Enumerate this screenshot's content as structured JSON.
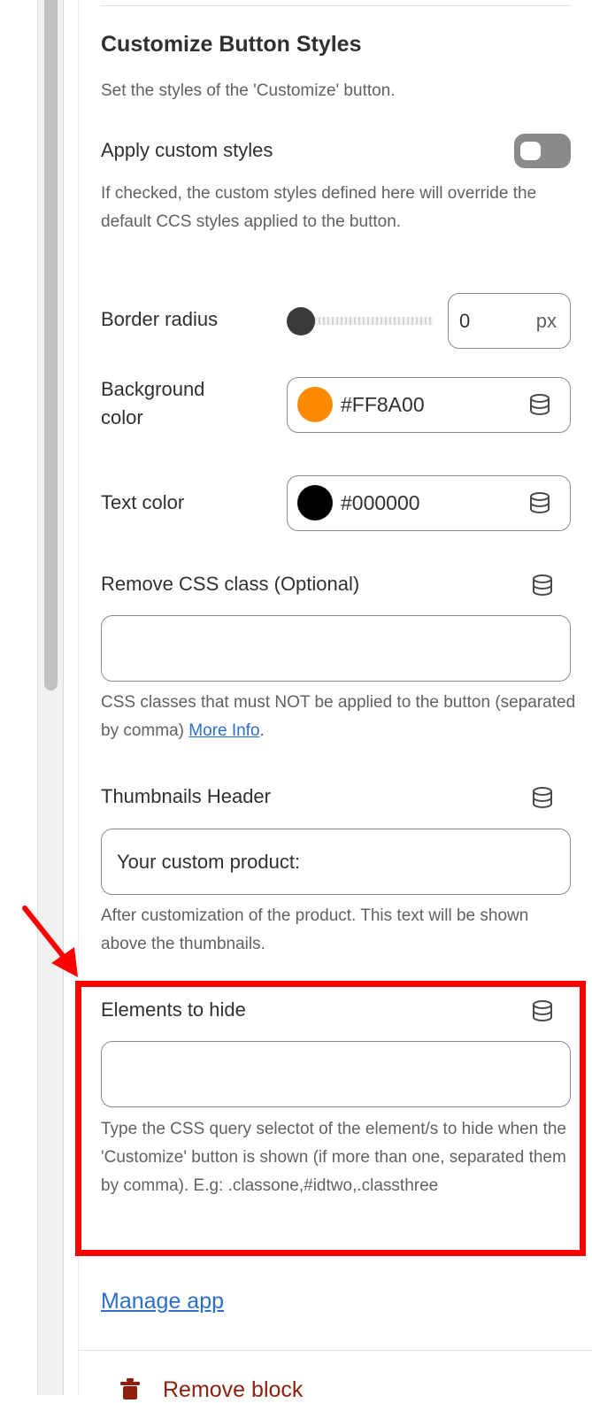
{
  "section": {
    "title": "Customize Button Styles",
    "subtitle": "Set the styles of the 'Customize' button."
  },
  "apply_custom_styles": {
    "label": "Apply custom styles",
    "checked": false,
    "help": "If checked, the custom styles defined here will override the default CCS styles applied to the button."
  },
  "border_radius": {
    "label": "Border radius",
    "value": "0",
    "unit": "px"
  },
  "background_color": {
    "label_line1": "Background",
    "label_line2": "color",
    "value": "#FF8A00",
    "swatch": "#FF8A00"
  },
  "text_color": {
    "label": "Text color",
    "value": "#000000",
    "swatch": "#000000"
  },
  "remove_css_class": {
    "label": "Remove CSS class (Optional)",
    "value": "",
    "help": "CSS classes that must NOT be applied to the button (separated by comma)",
    "link": "More Info",
    "link_suffix": "."
  },
  "thumbnails_header": {
    "label": "Thumbnails Header",
    "value": "Your custom product:",
    "help": "After customization of the product. This text will be shown above the thumbnails."
  },
  "elements_to_hide": {
    "label": "Elements to hide",
    "value": "",
    "help": "Type the CSS query selectot of the element/s to hide when the 'Customize' button is shown (if more than one, separated them by comma). E.g: .classone,#idtwo,.classthree"
  },
  "footer": {
    "manage_app": "Manage app",
    "remove_block": "Remove block"
  },
  "icons": {
    "dynamic_source": "database-icon",
    "remove": "trash-icon",
    "annotation": "red-arrow-icon"
  },
  "colors": {
    "annotation": "#ff0000",
    "link": "#2c6ecb",
    "critical": "#8e1f0b"
  }
}
